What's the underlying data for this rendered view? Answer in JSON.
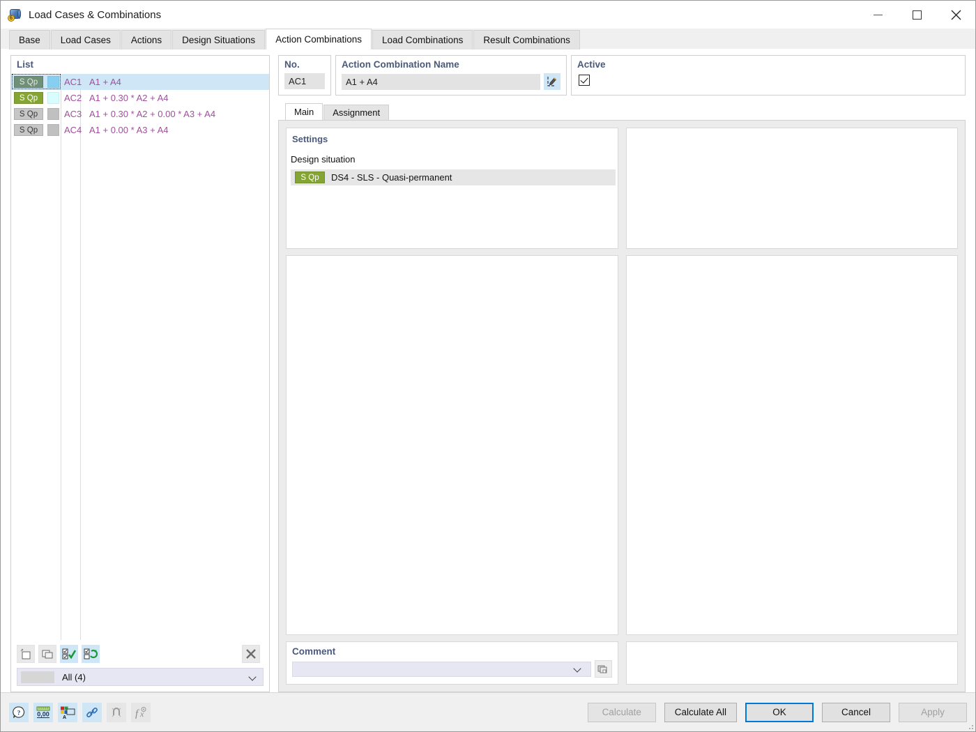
{
  "window": {
    "title": "Load Cases & Combinations",
    "icon": "load-cases-icon",
    "minimize_label": "Minimize",
    "maximize_label": "Maximize",
    "close_label": "Close"
  },
  "tabs": [
    {
      "label": "Base",
      "active": false
    },
    {
      "label": "Load Cases",
      "active": false
    },
    {
      "label": "Actions",
      "active": false
    },
    {
      "label": "Design Situations",
      "active": false
    },
    {
      "label": "Action Combinations",
      "active": true
    },
    {
      "label": "Load Combinations",
      "active": false
    },
    {
      "label": "Result Combinations",
      "active": false
    }
  ],
  "list_panel": {
    "caption": "List",
    "rows": [
      {
        "badge": "S Qp",
        "badge_color": "#6f8f77",
        "badge_text_color": "#dfe9e1",
        "swatch_color": "#87cff0",
        "no": "AC1",
        "expression": "A1 + A4",
        "selected": true
      },
      {
        "badge": "S Qp",
        "badge_color": "#84a434",
        "badge_text_color": "#ffffff",
        "swatch_color": "#d9fcfc",
        "no": "AC2",
        "expression": "A1 + 0.30 * A2 + A4",
        "selected": false
      },
      {
        "badge": "S Qp",
        "badge_color": "#c6c6c6",
        "badge_text_color": "#3b3b3b",
        "swatch_color": "#c0c0c0",
        "no": "AC3",
        "expression": "A1 + 0.30 * A2 + 0.00 * A3 + A4",
        "selected": false
      },
      {
        "badge": "S Qp",
        "badge_color": "#c6c6c6",
        "badge_text_color": "#3b3b3b",
        "swatch_color": "#c0c0c0",
        "no": "AC4",
        "expression": "A1 + 0.00 * A3 + A4",
        "selected": false
      }
    ],
    "toolbar": [
      {
        "name": "new-item-icon",
        "label": "New"
      },
      {
        "name": "copy-item-icon",
        "label": "Copy"
      },
      {
        "name": "select-all-icon",
        "label": "Select All"
      },
      {
        "name": "invert-selection-icon",
        "label": "Invert Selection"
      }
    ],
    "delete_label": "Delete",
    "filter": {
      "label": "All (4)",
      "chevron": "chevron-down-icon"
    }
  },
  "detail": {
    "no_group": {
      "title": "No.",
      "value": "AC1"
    },
    "name_group": {
      "title": "Action Combination Name",
      "value": "A1 + A4",
      "edit_icon": "edit-pencil-icon"
    },
    "active_group": {
      "title": "Active",
      "checked": true
    },
    "inner_tabs": [
      {
        "label": "Main",
        "active": true
      },
      {
        "label": "Assignment",
        "active": false
      }
    ],
    "settings": {
      "title": "Settings",
      "design_situation_label": "Design situation",
      "design_situation": {
        "badge": "S Qp",
        "badge_color": "#84a434",
        "badge_text_color": "#ffffff",
        "text": "DS4 - SLS - Quasi-permanent"
      }
    },
    "comment": {
      "title": "Comment",
      "value": "",
      "chevron": "chevron-down-icon",
      "button_icon": "copy-pages-icon"
    }
  },
  "footer": {
    "icons": [
      {
        "name": "help-icon",
        "label": "Help",
        "disabled": false
      },
      {
        "name": "units-icon",
        "label": "Units",
        "text": "0,00",
        "disabled": false
      },
      {
        "name": "display-properties-icon",
        "label": "Display Properties",
        "disabled": false
      },
      {
        "name": "link-icon",
        "label": "Link",
        "disabled": false
      },
      {
        "name": "snap-icon",
        "label": "Snap",
        "disabled": true
      },
      {
        "name": "formula-icon",
        "label": "Formula",
        "disabled": true
      }
    ],
    "buttons": [
      {
        "label": "Calculate",
        "disabled": true,
        "default": false
      },
      {
        "label": "Calculate All",
        "disabled": false,
        "default": false
      },
      {
        "label": "OK",
        "disabled": false,
        "default": true
      },
      {
        "label": "Cancel",
        "disabled": false,
        "default": false
      },
      {
        "label": "Apply",
        "disabled": true,
        "default": false
      }
    ]
  },
  "colors": {
    "accent_blue": "#0078d7",
    "header_text": "#4a5a7a",
    "list_text": "#a04f9c",
    "selection": "#cfe6f7"
  }
}
